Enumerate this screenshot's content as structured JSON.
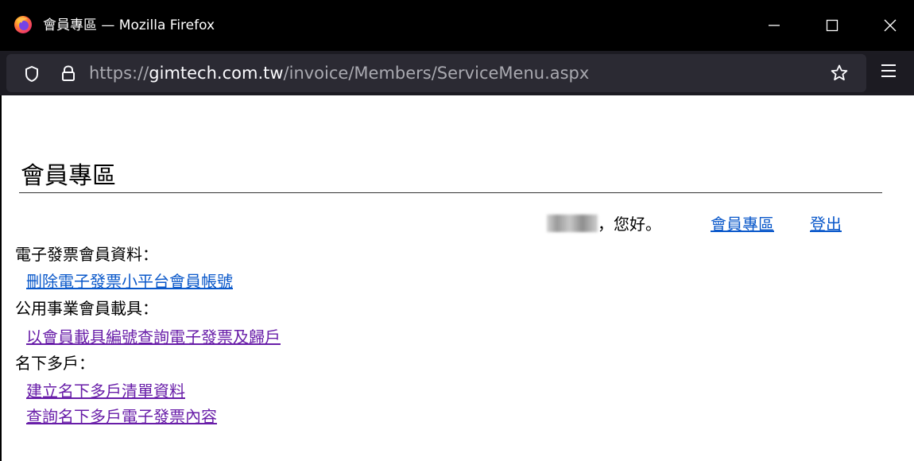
{
  "window": {
    "title": "會員專區 — Mozilla Firefox"
  },
  "address_bar": {
    "url_prefix": "https://",
    "url_host": "gimtech.com.tw",
    "url_path": "/invoice/Members/ServiceMenu.aspx"
  },
  "page": {
    "heading": "會員專區",
    "greeting_suffix": "，您好。",
    "header_links": {
      "member_area": "會員專區",
      "logout": "登出"
    },
    "sections": [
      {
        "title": "電子發票會員資料：",
        "links": [
          "刪除電子發票小平台會員帳號"
        ]
      },
      {
        "title": "公用事業會員載具：",
        "links": [
          "以會員載具編號查詢電子發票及歸戶"
        ]
      },
      {
        "title": "名下多戶：",
        "links": [
          "建立名下多戶清單資料",
          "查詢名下多戶電子發票內容"
        ]
      }
    ]
  },
  "colors": {
    "titlebar": "#000000",
    "toolbar": "#1c1b22",
    "urlbox": "#2b2a33",
    "link": "#0a58ca",
    "visited_link": "#681da8"
  }
}
